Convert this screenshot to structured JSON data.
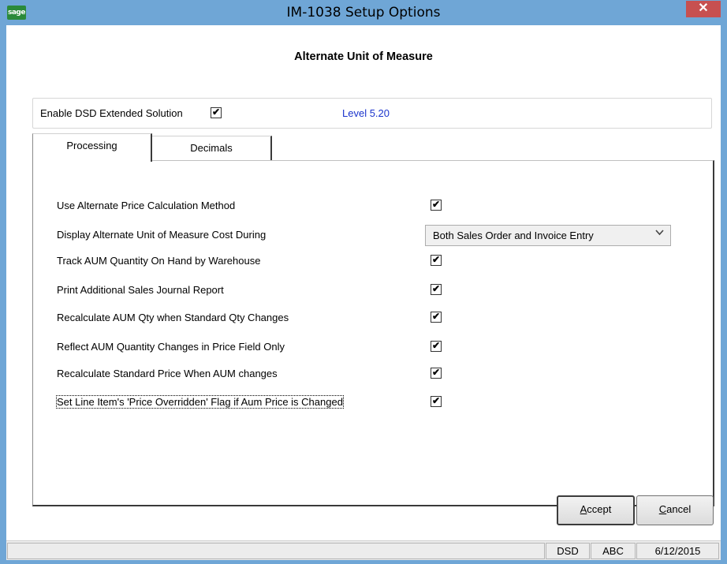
{
  "window": {
    "title": "IM-1038 Setup Options",
    "logo_text": "sage",
    "close_glyph": "✕"
  },
  "heading": "Alternate Unit of Measure",
  "enable": {
    "label": "Enable DSD Extended Solution",
    "checked": true,
    "level": "Level  5.20"
  },
  "tabs": [
    {
      "label": "Processing",
      "active": true
    },
    {
      "label": "Decimals",
      "active": false
    }
  ],
  "options": [
    {
      "label": "Use Alternate Price Calculation Method",
      "checked": true
    },
    {
      "label": "Display Alternate Unit of Measure Cost During",
      "select": "Both Sales Order and Invoice Entry"
    },
    {
      "label": "Track AUM Quantity On Hand by Warehouse",
      "checked": true
    },
    {
      "label": "Print Additional Sales Journal Report",
      "checked": true
    },
    {
      "label": "Recalculate AUM Qty when Standard Qty Changes",
      "checked": true
    },
    {
      "label": "Reflect AUM Quantity Changes in Price Field Only",
      "checked": true
    },
    {
      "label": "Recalculate Standard Price When AUM changes",
      "checked": true
    },
    {
      "label": "Set Line Item's 'Price Overridden' Flag if Aum Price is Changed",
      "checked": true
    }
  ],
  "buttons": {
    "accept_prefix": "A",
    "accept_rest": "ccept",
    "cancel_prefix": "C",
    "cancel_rest": "ancel"
  },
  "status": {
    "module": "DSD",
    "company": "ABC",
    "date": "6/12/2015"
  },
  "colors": {
    "titlebar": "#6fa6d6",
    "close": "#c75050",
    "level_text": "#1a33cc"
  },
  "icons": {
    "check": "✔",
    "dropdown": "⌄"
  }
}
